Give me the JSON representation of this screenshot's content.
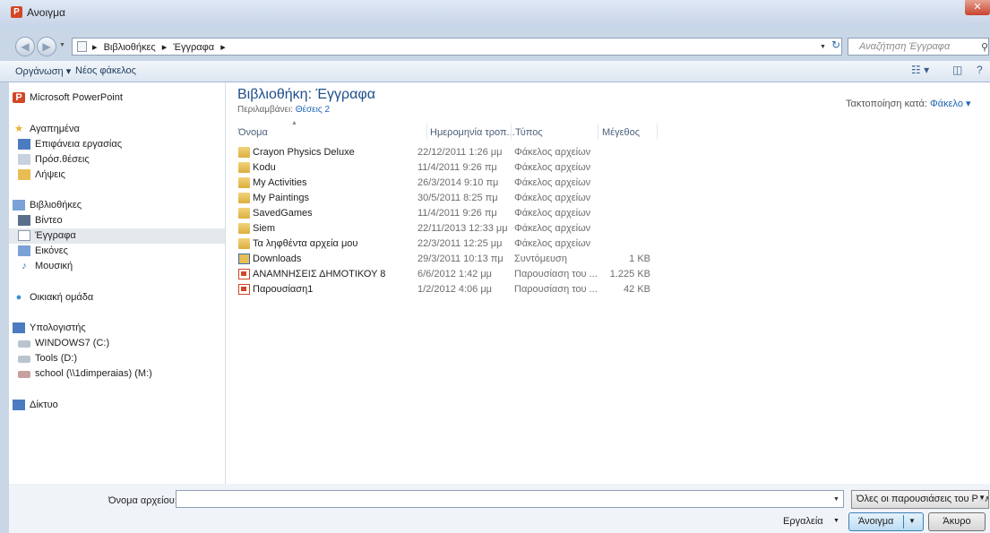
{
  "window": {
    "title": "Ανοιγμα",
    "app_icon": "P"
  },
  "address": {
    "crumbs": [
      "Βιβλιοθήκες",
      "Έγγραφα"
    ]
  },
  "search": {
    "placeholder": "Αναζήτηση Έγγραφα"
  },
  "toolbar": {
    "organize": "Οργάνωση ▾",
    "new_folder": "Νέος φάκελος"
  },
  "nav": {
    "powerpoint": "Microsoft PowerPoint",
    "favorites": "Αγαπημένα",
    "desktop": "Επιφάνεια εργασίας",
    "recent": "Πρόσ.θέσεις",
    "downloads": "Λήψεις",
    "libraries": "Βιβλιοθήκες",
    "videos": "Βίντεο",
    "documents": "Έγγραφα",
    "pictures": "Εικόνες",
    "music": "Μουσική",
    "homegroup": "Οικιακή ομάδα",
    "computer": "Υπολογιστής",
    "drive_c": "WINDOWS7 (C:)",
    "drive_d": "Tools (D:)",
    "drive_m": "school (\\\\1dimperaias) (M:)",
    "network": "Δίκτυο"
  },
  "library": {
    "title": "Βιβλιοθήκη: Έγγραφα",
    "includes_label": "Περιλαμβάνει:",
    "includes_link": "Θέσεις 2",
    "arrange_label": "Τακτοποίηση κατά:",
    "arrange_value": "Φάκελο ▾"
  },
  "columns": {
    "name": "Όνομα",
    "date": "Ημερομηνία τροπ...",
    "type": "Τύπος",
    "size": "Μέγεθος"
  },
  "files": [
    {
      "name": "Crayon Physics Deluxe",
      "date": "22/12/2011 1:26 μμ",
      "type": "Φάκελος αρχείων",
      "size": "",
      "icon": "folder"
    },
    {
      "name": "Kodu",
      "date": "11/4/2011 9:26 πμ",
      "type": "Φάκελος αρχείων",
      "size": "",
      "icon": "folder"
    },
    {
      "name": "My Activities",
      "date": "26/3/2014 9:10 πμ",
      "type": "Φάκελος αρχείων",
      "size": "",
      "icon": "folder"
    },
    {
      "name": "My Paintings",
      "date": "30/5/2011 8:25 πμ",
      "type": "Φάκελος αρχείων",
      "size": "",
      "icon": "folder"
    },
    {
      "name": "SavedGames",
      "date": "11/4/2011 9:26 πμ",
      "type": "Φάκελος αρχείων",
      "size": "",
      "icon": "folder"
    },
    {
      "name": "Siem",
      "date": "22/11/2013 12:33 μμ",
      "type": "Φάκελος αρχείων",
      "size": "",
      "icon": "folder"
    },
    {
      "name": "Τα ληφθέντα αρχεία μου",
      "date": "22/3/2011 12:25 μμ",
      "type": "Φάκελος αρχείων",
      "size": "",
      "icon": "folder"
    },
    {
      "name": "Downloads",
      "date": "29/3/2011 10:13 πμ",
      "type": "Συντόμευση",
      "size": "1 KB",
      "icon": "shortcut"
    },
    {
      "name": "ΑΝΑΜΝΗΣΕΙΣ ΔΗΜΟΤΙΚΟΥ 8",
      "date": "6/6/2012 1:42 μμ",
      "type": "Παρουσίαση του ...",
      "size": "1.225 KB",
      "icon": "ppt"
    },
    {
      "name": "Παρουσίαση1",
      "date": "1/2/2012 4:06 μμ",
      "type": "Παρουσίαση του ...",
      "size": "42 KB",
      "icon": "ppt"
    }
  ],
  "bottom": {
    "filename_label": "Όνομα αρχείου:",
    "filename_value": "",
    "filetype": "Όλες οι παρουσιάσεις του Pow",
    "tools": "Εργαλεία",
    "open": "Άνοιγμα",
    "cancel": "Άκυρο"
  }
}
